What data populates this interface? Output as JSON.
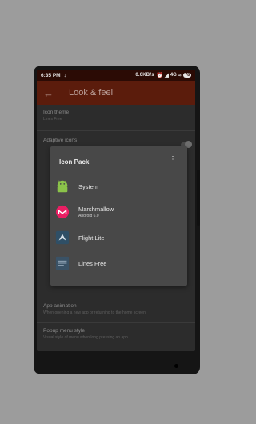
{
  "status_bar": {
    "time": "6:35 PM",
    "download_icon": "download-arrow-icon",
    "right_text": "0.0KB/s",
    "network": "4G",
    "battery": "78"
  },
  "toolbar": {
    "back_icon": "arrow-back-icon",
    "title": "Look & feel"
  },
  "settings": [
    {
      "title": "Icon theme",
      "subtitle": "Lines Free"
    },
    {
      "title": "Adaptive icons",
      "subtitle": ""
    },
    {
      "title": "App animation",
      "subtitle": "When opening a new app or returning to the home screen"
    },
    {
      "title": "Popup menu style",
      "subtitle": "Visual style of menu when long pressing an app"
    }
  ],
  "dialog": {
    "title": "Icon Pack",
    "menu_icon": "more-vert-icon",
    "items": [
      {
        "label": "System",
        "sublabel": "",
        "icon": "android-robot-icon",
        "color": "#8bc34a"
      },
      {
        "label": "Marshmallow",
        "sublabel": "Android 6.0",
        "icon": "marshmallow-icon",
        "color": "#e91e63"
      },
      {
        "label": "Flight Lite",
        "sublabel": "",
        "icon": "flight-lite-icon",
        "color": "#2f4f66"
      },
      {
        "label": "Lines Free",
        "sublabel": "",
        "icon": "lines-free-icon",
        "color": "#3a5266"
      }
    ]
  },
  "colors": {
    "background": "#9c9c9c",
    "toolbar": "#5b1c0c",
    "status_bar": "#2b0b05",
    "dialog": "#484848"
  }
}
